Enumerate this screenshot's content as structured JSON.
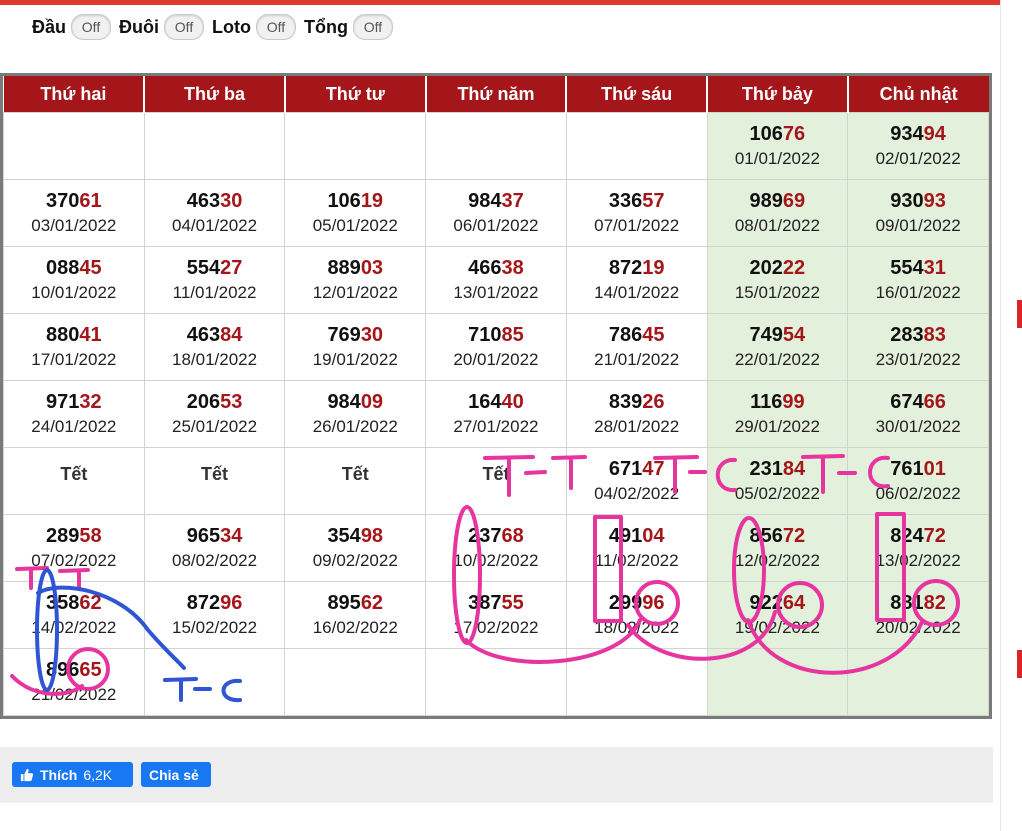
{
  "toggles": [
    {
      "label": "Đầu",
      "state": "Off"
    },
    {
      "label": "Đuôi",
      "state": "Off"
    },
    {
      "label": "Loto",
      "state": "Off"
    },
    {
      "label": "Tổng",
      "state": "Off"
    }
  ],
  "calendar": {
    "headers": [
      "Thứ hai",
      "Thứ ba",
      "Thứ tư",
      "Thứ năm",
      "Thứ sáu",
      "Thứ bảy",
      "Chủ nhật"
    ],
    "rows": [
      [
        null,
        null,
        null,
        null,
        null,
        {
          "head": "106",
          "tail": "76",
          "date": "01/01/2022"
        },
        {
          "head": "934",
          "tail": "94",
          "date": "02/01/2022"
        }
      ],
      [
        {
          "head": "370",
          "tail": "61",
          "date": "03/01/2022"
        },
        {
          "head": "463",
          "tail": "30",
          "date": "04/01/2022"
        },
        {
          "head": "106",
          "tail": "19",
          "date": "05/01/2022"
        },
        {
          "head": "984",
          "tail": "37",
          "date": "06/01/2022"
        },
        {
          "head": "336",
          "tail": "57",
          "date": "07/01/2022"
        },
        {
          "head": "989",
          "tail": "69",
          "date": "08/01/2022"
        },
        {
          "head": "930",
          "tail": "93",
          "date": "09/01/2022"
        }
      ],
      [
        {
          "head": "088",
          "tail": "45",
          "date": "10/01/2022"
        },
        {
          "head": "554",
          "tail": "27",
          "date": "11/01/2022"
        },
        {
          "head": "889",
          "tail": "03",
          "date": "12/01/2022"
        },
        {
          "head": "466",
          "tail": "38",
          "date": "13/01/2022"
        },
        {
          "head": "872",
          "tail": "19",
          "date": "14/01/2022"
        },
        {
          "head": "202",
          "tail": "22",
          "date": "15/01/2022"
        },
        {
          "head": "554",
          "tail": "31",
          "date": "16/01/2022"
        }
      ],
      [
        {
          "head": "880",
          "tail": "41",
          "date": "17/01/2022"
        },
        {
          "head": "463",
          "tail": "84",
          "date": "18/01/2022"
        },
        {
          "head": "769",
          "tail": "30",
          "date": "19/01/2022"
        },
        {
          "head": "710",
          "tail": "85",
          "date": "20/01/2022"
        },
        {
          "head": "786",
          "tail": "45",
          "date": "21/01/2022"
        },
        {
          "head": "749",
          "tail": "54",
          "date": "22/01/2022"
        },
        {
          "head": "283",
          "tail": "83",
          "date": "23/01/2022"
        }
      ],
      [
        {
          "head": "971",
          "tail": "32",
          "date": "24/01/2022"
        },
        {
          "head": "206",
          "tail": "53",
          "date": "25/01/2022"
        },
        {
          "head": "984",
          "tail": "09",
          "date": "26/01/2022"
        },
        {
          "head": "164",
          "tail": "40",
          "date": "27/01/2022"
        },
        {
          "head": "839",
          "tail": "26",
          "date": "28/01/2022"
        },
        {
          "head": "116",
          "tail": "99",
          "date": "29/01/2022"
        },
        {
          "head": "674",
          "tail": "66",
          "date": "30/01/2022"
        }
      ],
      [
        {
          "tet": "Tết"
        },
        {
          "tet": "Tết"
        },
        {
          "tet": "Tết"
        },
        {
          "tet": "Tết"
        },
        {
          "head": "671",
          "tail": "47",
          "date": "04/02/2022"
        },
        {
          "head": "231",
          "tail": "84",
          "date": "05/02/2022"
        },
        {
          "head": "761",
          "tail": "01",
          "date": "06/02/2022"
        }
      ],
      [
        {
          "head": "289",
          "tail": "58",
          "date": "07/02/2022"
        },
        {
          "head": "965",
          "tail": "34",
          "date": "08/02/2022"
        },
        {
          "head": "354",
          "tail": "98",
          "date": "09/02/2022"
        },
        {
          "head": "237",
          "tail": "68",
          "date": "10/02/2022"
        },
        {
          "head": "491",
          "tail": "04",
          "date": "11/02/2022"
        },
        {
          "head": "856",
          "tail": "72",
          "date": "12/02/2022"
        },
        {
          "head": "824",
          "tail": "72",
          "date": "13/02/2022"
        }
      ],
      [
        {
          "head": "358",
          "tail": "62",
          "date": "14/02/2022"
        },
        {
          "head": "872",
          "tail": "96",
          "date": "15/02/2022"
        },
        {
          "head": "895",
          "tail": "62",
          "date": "16/02/2022"
        },
        {
          "head": "387",
          "tail": "55",
          "date": "17/02/2022"
        },
        {
          "head": "299",
          "tail": "96",
          "date": "18/02/2022"
        },
        {
          "head": "922",
          "tail": "64",
          "date": "19/02/2022"
        },
        {
          "head": "881",
          "tail": "82",
          "date": "20/02/2022"
        }
      ],
      [
        {
          "head": "896",
          "tail": "65",
          "date": "21/02/2022"
        },
        null,
        null,
        null,
        null,
        null,
        null
      ]
    ]
  },
  "annotations": {
    "labels": [
      "T-T",
      "T-C",
      "T-C",
      "T-C",
      "T-C"
    ],
    "pink": "#e6359f",
    "blue": "#2f55d4"
  },
  "social": {
    "like_label": "Thích",
    "like_count": "6,2K",
    "share_label": "Chia sẻ",
    "color": "#1877f2"
  }
}
